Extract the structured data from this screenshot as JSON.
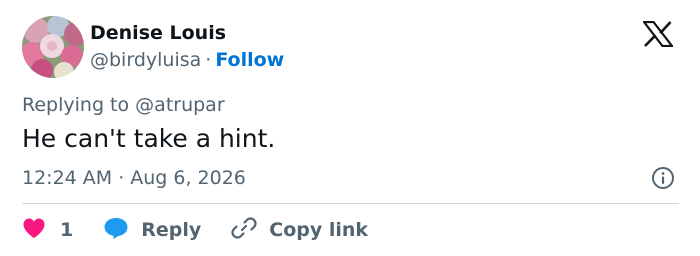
{
  "author": {
    "display_name": "Denise Louis",
    "handle": "@birdyluisa",
    "separator": "·",
    "follow_label": "Follow"
  },
  "reply_context": {
    "prefix": "Replying to",
    "mention": "@atrupar"
  },
  "tweet": {
    "text": "He can't take a hint.",
    "time": "12:24 AM",
    "separator": "·",
    "date": "Aug 6, 2026"
  },
  "actions": {
    "like_count": "1",
    "reply_label": "Reply",
    "copy_link_label": "Copy link"
  },
  "icons": {
    "brand": "x-logo-icon",
    "info": "info-icon",
    "like": "heart-icon",
    "reply": "speech-bubble-icon",
    "copy": "link-icon"
  },
  "colors": {
    "text_primary": "#0f1419",
    "text_secondary": "#536471",
    "link_blue": "#0074d4",
    "like_pink": "#f91880",
    "reply_blue": "#1d9bf0",
    "divider": "#cfd9de"
  }
}
